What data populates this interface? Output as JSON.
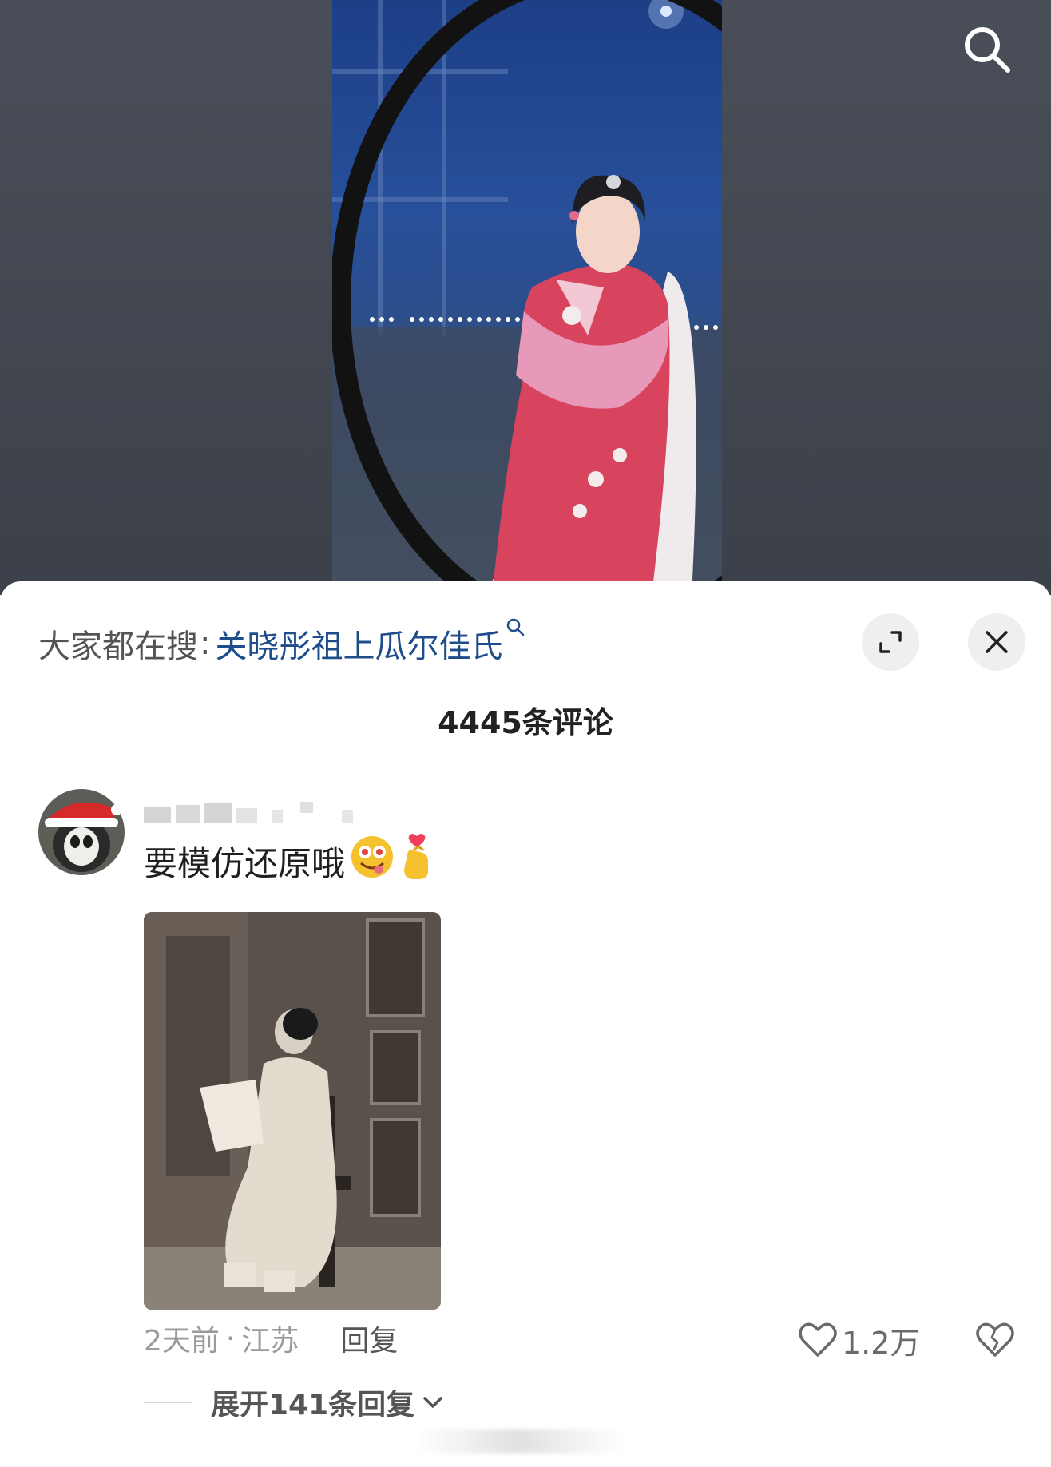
{
  "video": {
    "background_color": "#3f434c",
    "search_icon": "search-icon"
  },
  "comments_sheet": {
    "trending": {
      "prefix": "大家都在搜",
      "separator": ":",
      "query": "关晓彤祖上瓜尔佳氏",
      "query_color": "#1f4d8c",
      "search_icon": "search-icon"
    },
    "expand_icon": "expand-icon",
    "close_icon": "close-icon",
    "comment_count": "4445条评论"
  },
  "comment": {
    "avatar_icon": "avatar-santa-hat",
    "text": "要模仿还原哦",
    "emojis": [
      "drooling-face-emoji",
      "finger-heart-emoji"
    ],
    "time": "2天前",
    "dot": "·",
    "location": "江苏",
    "reply_label": "回复",
    "likes": "1.2万",
    "like_icon": "heart-icon",
    "dislike_icon": "broken-heart-icon",
    "expand_replies": "展开141条回复",
    "chevron_icon": "chevron-down-icon"
  }
}
